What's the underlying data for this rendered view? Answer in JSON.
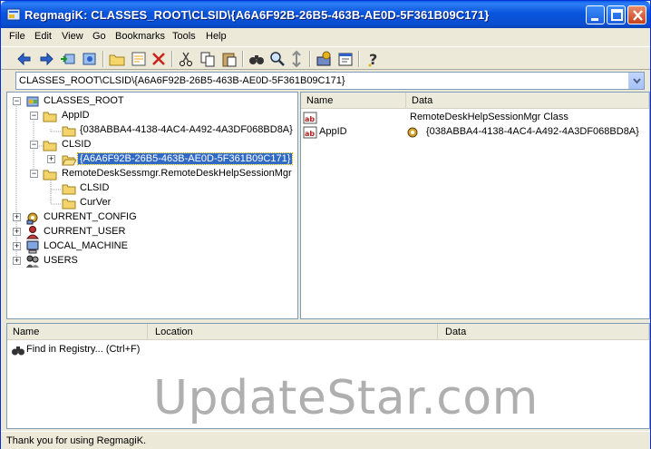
{
  "window": {
    "title": "RegmagiK: CLASSES_ROOT\\CLSID\\{A6A6F92B-26B5-463B-AE0D-5F361B09C171}",
    "accent": "#0a4fd1",
    "titlebar_buttons": [
      "minimize-icon",
      "maximize-icon",
      "close-icon"
    ]
  },
  "menu": {
    "items": [
      {
        "label": "File"
      },
      {
        "label": "Edit"
      },
      {
        "label": "View"
      },
      {
        "label": "Go"
      },
      {
        "label": "Bookmarks"
      },
      {
        "label": "Tools"
      },
      {
        "label": "Help"
      }
    ]
  },
  "toolbar": {
    "icons": [
      "back-arrow-icon",
      "forward-arrow-icon",
      "import-icon",
      "export-icon",
      "new-key-icon",
      "new-value-icon",
      "delete-icon",
      "cut-icon",
      "copy-icon",
      "paste-icon",
      "find-icon",
      "find-next-icon",
      "replace-icon",
      "registry-icon",
      "properties-icon",
      "help-icon"
    ]
  },
  "address": {
    "value": "CLASSES_ROOT\\CLSID\\{A6A6F92B-26B5-463B-AE0D-5F361B09C171}"
  },
  "tree": {
    "nodes": [
      {
        "label": "CLASSES_ROOT",
        "expander": "−"
      },
      {
        "label": "AppID",
        "expander": "−"
      },
      {
        "label": "{038ABBA4-4138-4AC4-A492-4A3DF068BD8A}",
        "expander": ""
      },
      {
        "label": "CLSID",
        "expander": "−"
      },
      {
        "label": "{A6A6F92B-26B5-463B-AE0D-5F361B09C171}",
        "expander": "+"
      },
      {
        "label": "RemoteDeskSessmgr.RemoteDeskHelpSessionMgr",
        "expander": "−"
      },
      {
        "label": "CLSID",
        "expander": ""
      },
      {
        "label": "CurVer",
        "expander": ""
      },
      {
        "label": "CURRENT_CONFIG",
        "expander": "+"
      },
      {
        "label": "CURRENT_USER",
        "expander": "+"
      },
      {
        "label": "LOCAL_MACHINE",
        "expander": "+"
      },
      {
        "label": "USERS",
        "expander": "+"
      }
    ]
  },
  "values_list": {
    "columns": [
      "Name",
      "Data"
    ],
    "rows": [
      {
        "name": "",
        "data": "RemoteDeskHelpSessionMgr Class"
      },
      {
        "name": "AppID",
        "data": "{038ABBA4-4138-4AC4-A492-4A3DF068BD8A}"
      }
    ]
  },
  "find_results": {
    "columns": [
      "Name",
      "Location",
      "Data"
    ],
    "rows": [
      {
        "name": "Find in Registry... (Ctrl+F)"
      }
    ]
  },
  "status": {
    "text": "Thank you for using RegmagiK."
  },
  "watermark": {
    "text": "UpdateStar.com"
  }
}
